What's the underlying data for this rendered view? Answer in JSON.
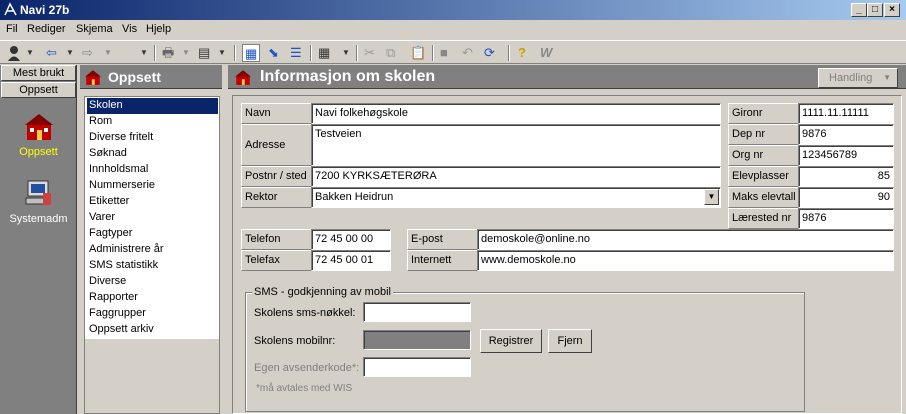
{
  "window": {
    "title": "Navi 27b",
    "controls": [
      "_",
      "□",
      "×"
    ]
  },
  "menu": [
    "Fil",
    "Rediger",
    "Skjema",
    "Vis",
    "Hjelp"
  ],
  "leftnav": {
    "top_buttons": [
      "Mest brukt",
      "Oppsett"
    ],
    "items": [
      {
        "label": "Oppsett",
        "icon": "school-house-icon",
        "active": true
      },
      {
        "label": "Systemadm",
        "icon": "computer-admin-icon",
        "active": false
      }
    ],
    "active_color": "#ffff00"
  },
  "midpanel": {
    "title": "Oppsett",
    "items": [
      "Skolen",
      "Rom",
      "Diverse fritelt",
      "Søknad",
      "Innholdsmal",
      "Nummerserie",
      "Etiketter",
      "Varer",
      "Fagtyper",
      "Administrere år",
      "SMS statistikk",
      "Diverse",
      "Rapporter",
      "Faggrupper",
      "Oppsett arkiv"
    ],
    "selected": "Skolen"
  },
  "main": {
    "title": "Informasjon om skolen",
    "action_button": "Handling",
    "fields": {
      "navn_label": "Navn",
      "navn": "Navi folkehøgskole",
      "adresse_label": "Adresse",
      "adresse": "Testveien",
      "postnr_label": "Postnr / sted",
      "postnr": "7200 KYRKSÆTERØRA",
      "rektor_label": "Rektor",
      "rektor": "Bakken Heidrun",
      "telefon_label": "Telefon",
      "telefon": "72 45 00 00",
      "telefax_label": "Telefax",
      "telefax": "72 45 00 01",
      "epost_label": "E-post",
      "epost": "demoskole@online.no",
      "internett_label": "Internett",
      "internett": "www.demoskole.no",
      "gironr_label": "Gironr",
      "gironr": "1111.11.11111",
      "depnr_label": "Dep nr",
      "depnr": "9876",
      "orgnr_label": "Org nr",
      "orgnr": "123456789",
      "elevplasser_label": "Elevplasser",
      "elevplasser": "85",
      "maks_label": "Maks elevtall",
      "maks": "90",
      "laerested_label": "Lærested nr",
      "laerested": "9876"
    },
    "sms": {
      "group_title": "SMS - godkjenning av mobil",
      "key_label": "Skolens sms-nøkkel:",
      "mobile_label": "Skolens mobilnr:",
      "sender_label": "Egen avsenderkode*:",
      "note": "*må avtales med WIS",
      "register_button": "Registrer",
      "remove_button": "Fjern"
    }
  },
  "colors": {
    "titlebar_start": "#0a246a",
    "titlebar_end": "#a6caf0",
    "face": "#d4d0c8",
    "panel_header": "#808080",
    "selection": "#0a246a"
  }
}
